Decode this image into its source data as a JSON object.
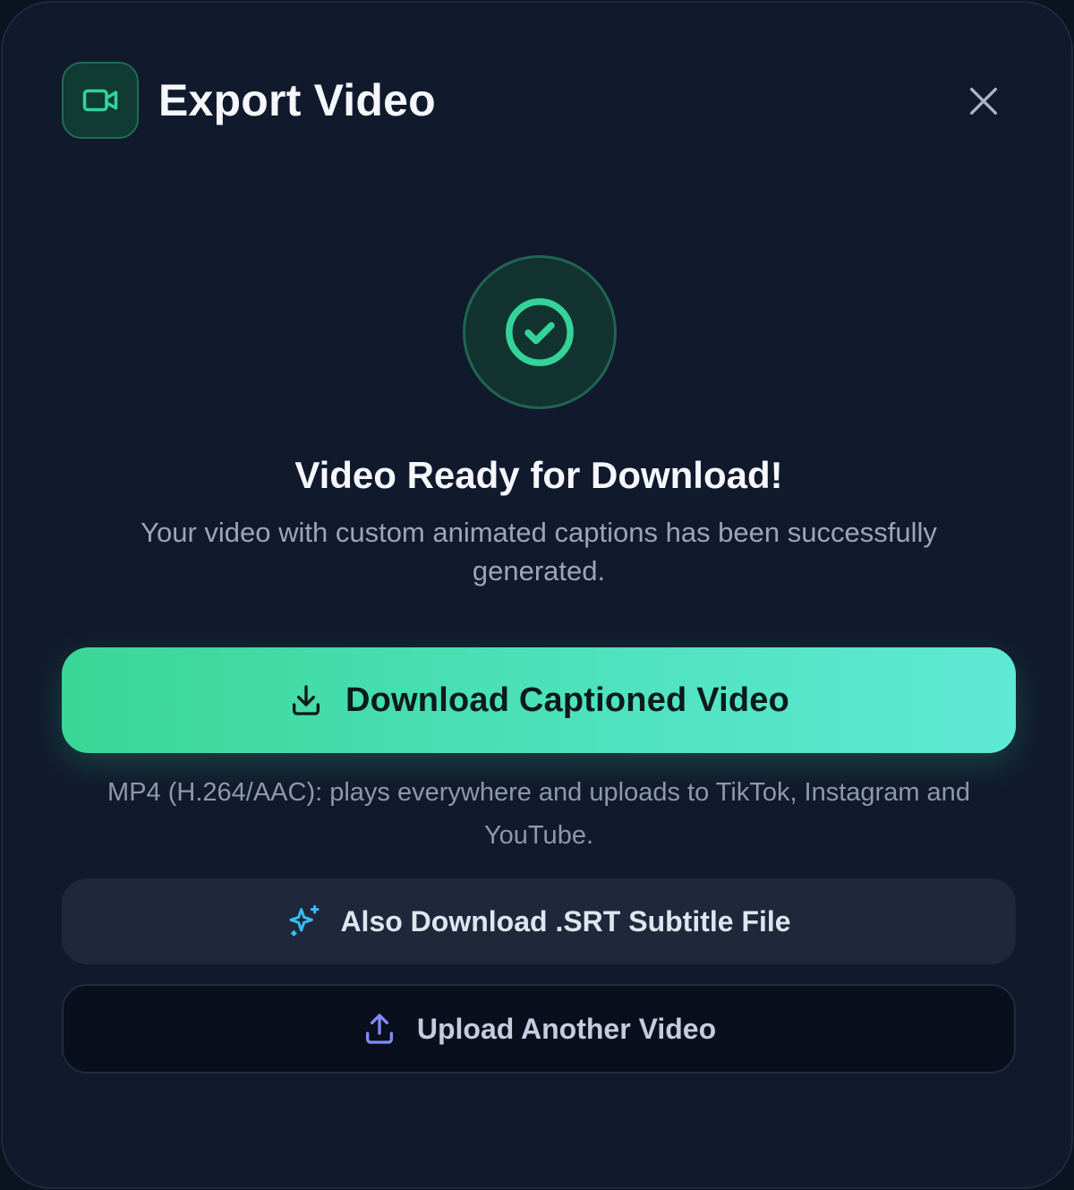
{
  "header": {
    "title": "Export Video",
    "icon": "video-camera-icon",
    "close_icon": "close-icon"
  },
  "status": {
    "icon": "check-circle-icon",
    "title": "Video Ready for Download!",
    "description": "Your video with custom animated captions has been successfully generated."
  },
  "actions": {
    "download_video": {
      "label": "Download Captioned Video",
      "icon": "download-icon"
    },
    "format_note": "MP4 (H.264/AAC): plays everywhere and uploads to TikTok, Instagram and YouTube.",
    "download_srt": {
      "label": "Also Download .SRT Subtitle File",
      "icon": "sparkles-icon"
    },
    "upload_another": {
      "label": "Upload Another Video",
      "icon": "upload-icon"
    }
  },
  "colors": {
    "accent": "#34d399",
    "accent_end": "#5ee9d6",
    "background": "#111a2c",
    "sparkle": "#38bdf8",
    "upload": "#818cf8"
  }
}
